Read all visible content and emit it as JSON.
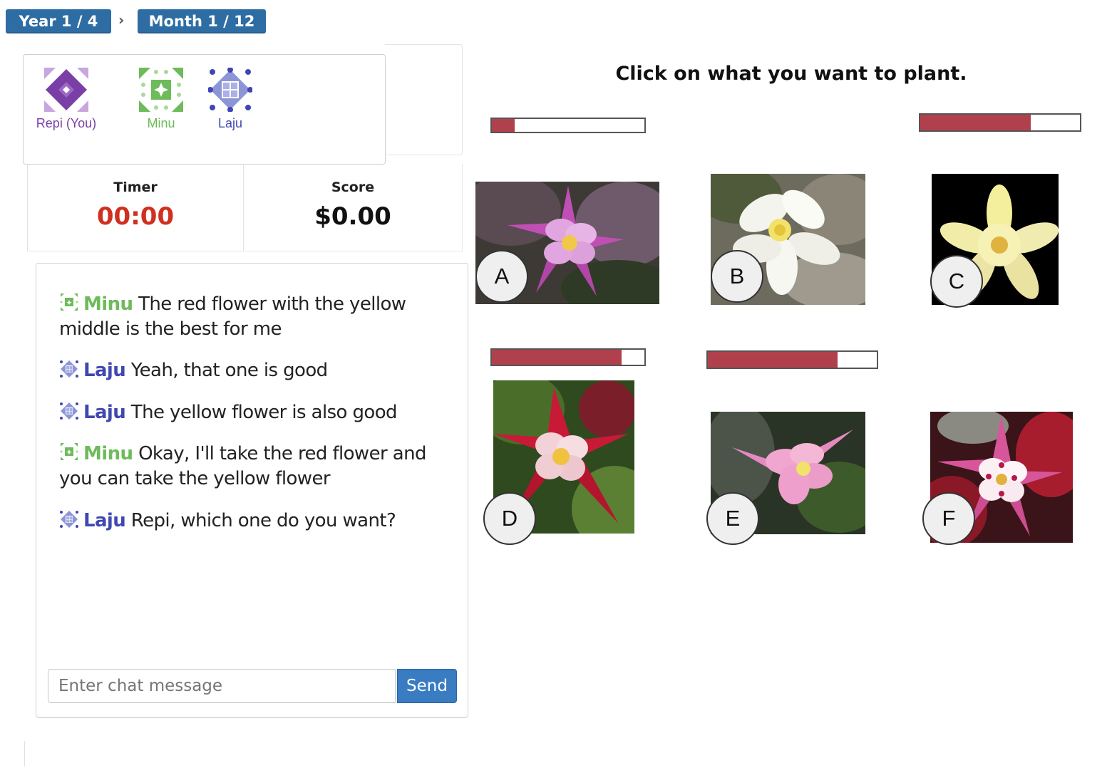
{
  "breadcrumb": {
    "year": "Year 1 / 4",
    "separator": "›",
    "month": "Month 1 / 12"
  },
  "players": [
    {
      "name": "Repi (You)",
      "color": "#7a3fa6"
    },
    {
      "name": "Minu",
      "color": "#6dbb5a"
    },
    {
      "name": "Laju",
      "color": "#3f47b1"
    }
  ],
  "stats": {
    "timer_label": "Timer",
    "timer_value": "00:00",
    "timer_color": "#d0301f",
    "score_label": "Score",
    "score_value": "$0.00"
  },
  "chat": {
    "messages": [
      {
        "sender": "Minu",
        "text": " The red flower with the yellow middle is the best for me"
      },
      {
        "sender": "Laju",
        "text": " Yeah, that one is good"
      },
      {
        "sender": "Laju",
        "text": " The yellow flower is also good"
      },
      {
        "sender": "Minu",
        "text": " Okay, I'll take the red flower and you can take the yellow flower"
      },
      {
        "sender": "Laju",
        "text": " Repi, which one do you want?"
      }
    ],
    "input_placeholder": "Enter chat message",
    "send_label": "Send"
  },
  "instruction": "Click on what you want to plant.",
  "bar_color": "#b0414c",
  "flowers": [
    {
      "label": "A",
      "bar_fill": 0.15
    },
    {
      "label": "B"
    },
    {
      "label": "C",
      "bar_fill": 0.69
    },
    {
      "label": "D",
      "bar_fill": 0.85
    },
    {
      "label": "E",
      "bar_fill": 0.77
    },
    {
      "label": "F"
    }
  ]
}
